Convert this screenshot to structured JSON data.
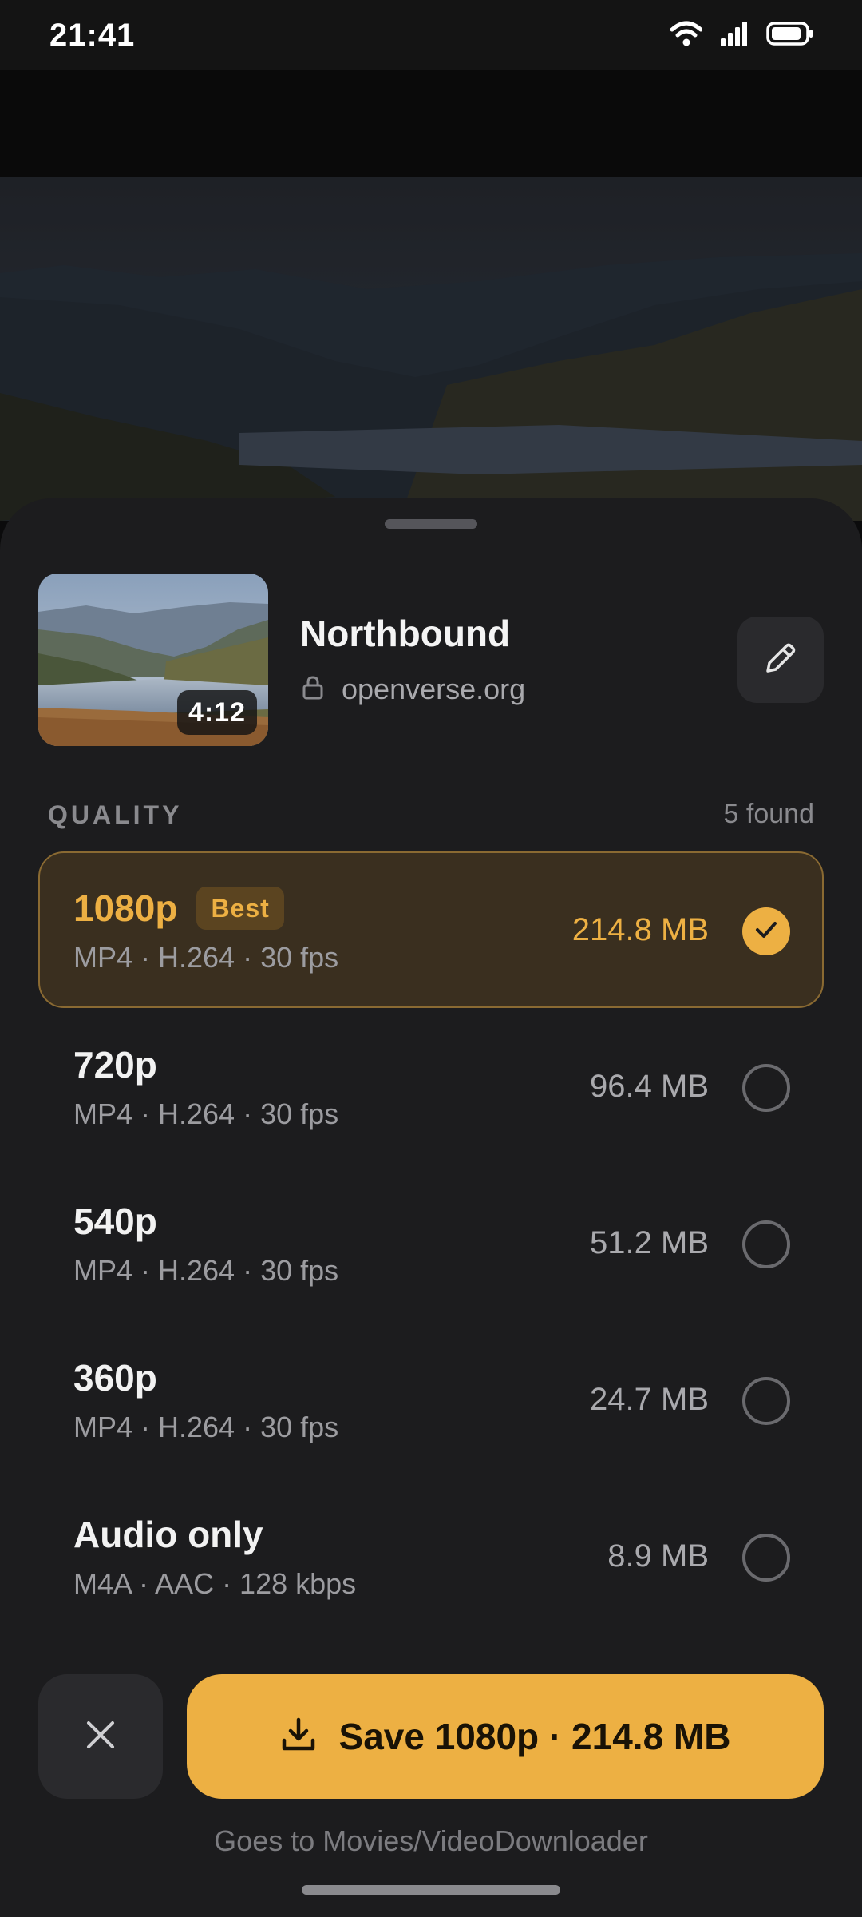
{
  "status_bar": {
    "time": "21:41"
  },
  "video": {
    "title": "Northbound",
    "source": "openverse.org",
    "duration": "4:12"
  },
  "quality": {
    "heading": "QUALITY",
    "found": "5 found",
    "options": [
      {
        "name": "1080p",
        "badge": "Best",
        "details": "MP4 · H.264 · 30 fps",
        "size": "214.8 MB",
        "selected": true
      },
      {
        "name": "720p",
        "details": "MP4 · H.264 · 30 fps",
        "size": "96.4 MB",
        "selected": false
      },
      {
        "name": "540p",
        "details": "MP4 · H.264 · 30 fps",
        "size": "51.2 MB",
        "selected": false
      },
      {
        "name": "360p",
        "details": "MP4 · H.264 · 30 fps",
        "size": "24.7 MB",
        "selected": false
      },
      {
        "name": "Audio only",
        "details": "M4A · AAC · 128 kbps",
        "size": "8.9 MB",
        "selected": false
      }
    ]
  },
  "actions": {
    "save_label": "Save 1080p · 214.8 MB",
    "destination": "Goes to Movies/VideoDownloader"
  },
  "icons": {
    "wifi": "wifi-icon",
    "signal": "signal-icon",
    "battery": "battery-icon",
    "lock": "lock-icon",
    "edit": "pencil-icon",
    "check": "check-icon",
    "close": "close-icon",
    "download": "download-icon"
  },
  "colors": {
    "accent": "#edb043",
    "sheet": "#1c1c1e",
    "selected_bg": "#3a2f1f"
  }
}
